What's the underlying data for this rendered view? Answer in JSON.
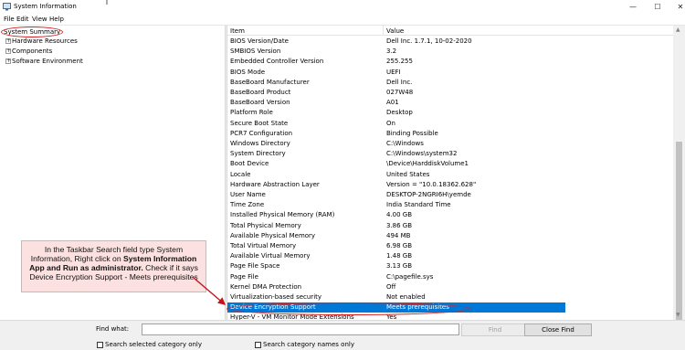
{
  "window": {
    "title": "System Information",
    "minimize": "—",
    "maximize": "☐",
    "close": "✕"
  },
  "menu": [
    "File",
    "Edit",
    "View",
    "Help"
  ],
  "tree": {
    "root": "System Summary",
    "children": [
      "Hardware Resources",
      "Components",
      "Software Environment"
    ]
  },
  "list": {
    "headers": {
      "item": "Item",
      "value": "Value"
    },
    "rows": [
      {
        "item": "BIOS Version/Date",
        "value": "Dell Inc. 1.7.1, 10-02-2020"
      },
      {
        "item": "SMBIOS Version",
        "value": "3.2"
      },
      {
        "item": "Embedded Controller Version",
        "value": "255.255"
      },
      {
        "item": "BIOS Mode",
        "value": "UEFI"
      },
      {
        "item": "BaseBoard Manufacturer",
        "value": "Dell Inc."
      },
      {
        "item": "BaseBoard Product",
        "value": "027W48"
      },
      {
        "item": "BaseBoard Version",
        "value": "A01"
      },
      {
        "item": "Platform Role",
        "value": "Desktop"
      },
      {
        "item": "Secure Boot State",
        "value": "On"
      },
      {
        "item": "PCR7 Configuration",
        "value": "Binding Possible"
      },
      {
        "item": "Windows Directory",
        "value": "C:\\Windows"
      },
      {
        "item": "System Directory",
        "value": "C:\\Windows\\system32"
      },
      {
        "item": "Boot Device",
        "value": "\\Device\\HarddiskVolume1"
      },
      {
        "item": "Locale",
        "value": "United States"
      },
      {
        "item": "Hardware Abstraction Layer",
        "value": "Version = \"10.0.18362.628\""
      },
      {
        "item": "User Name",
        "value": "DESKTOP-2NGRI6H\\yemde"
      },
      {
        "item": "Time Zone",
        "value": "India Standard Time"
      },
      {
        "item": "Installed Physical Memory (RAM)",
        "value": "4.00 GB"
      },
      {
        "item": "Total Physical Memory",
        "value": "3.86 GB"
      },
      {
        "item": "Available Physical Memory",
        "value": "494 MB"
      },
      {
        "item": "Total Virtual Memory",
        "value": "6.98 GB"
      },
      {
        "item": "Available Virtual Memory",
        "value": "1.48 GB"
      },
      {
        "item": "Page File Space",
        "value": "3.13 GB"
      },
      {
        "item": "Page File",
        "value": "C:\\pagefile.sys"
      },
      {
        "item": "Kernel DMA Protection",
        "value": "Off"
      },
      {
        "item": "Virtualization-based security",
        "value": "Not enabled"
      },
      {
        "item": "Device Encryption Support",
        "value": "Meets prerequisites",
        "selected": true
      },
      {
        "item": "Hyper-V - VM Monitor Mode Extensions",
        "value": "Yes"
      }
    ]
  },
  "callout": {
    "line1": "In the Taskbar Search field type System",
    "line2a": "Information, Right click  on ",
    "line2b": "System Information",
    "line3a": "App  and Run as  administrator.",
    "line3b": " Check if it says",
    "line4": "Device Encryption Support - Meets  prerequisites"
  },
  "find": {
    "label": "Find what:",
    "value": "",
    "find_button": "Find",
    "close_find_button": "Close Find",
    "check_selected": "Search selected category only",
    "check_names": "Search category names only"
  },
  "colors": {
    "selection": "#0078d7",
    "annotation_red": "#d42020",
    "callout_bg": "#fce1e1"
  }
}
